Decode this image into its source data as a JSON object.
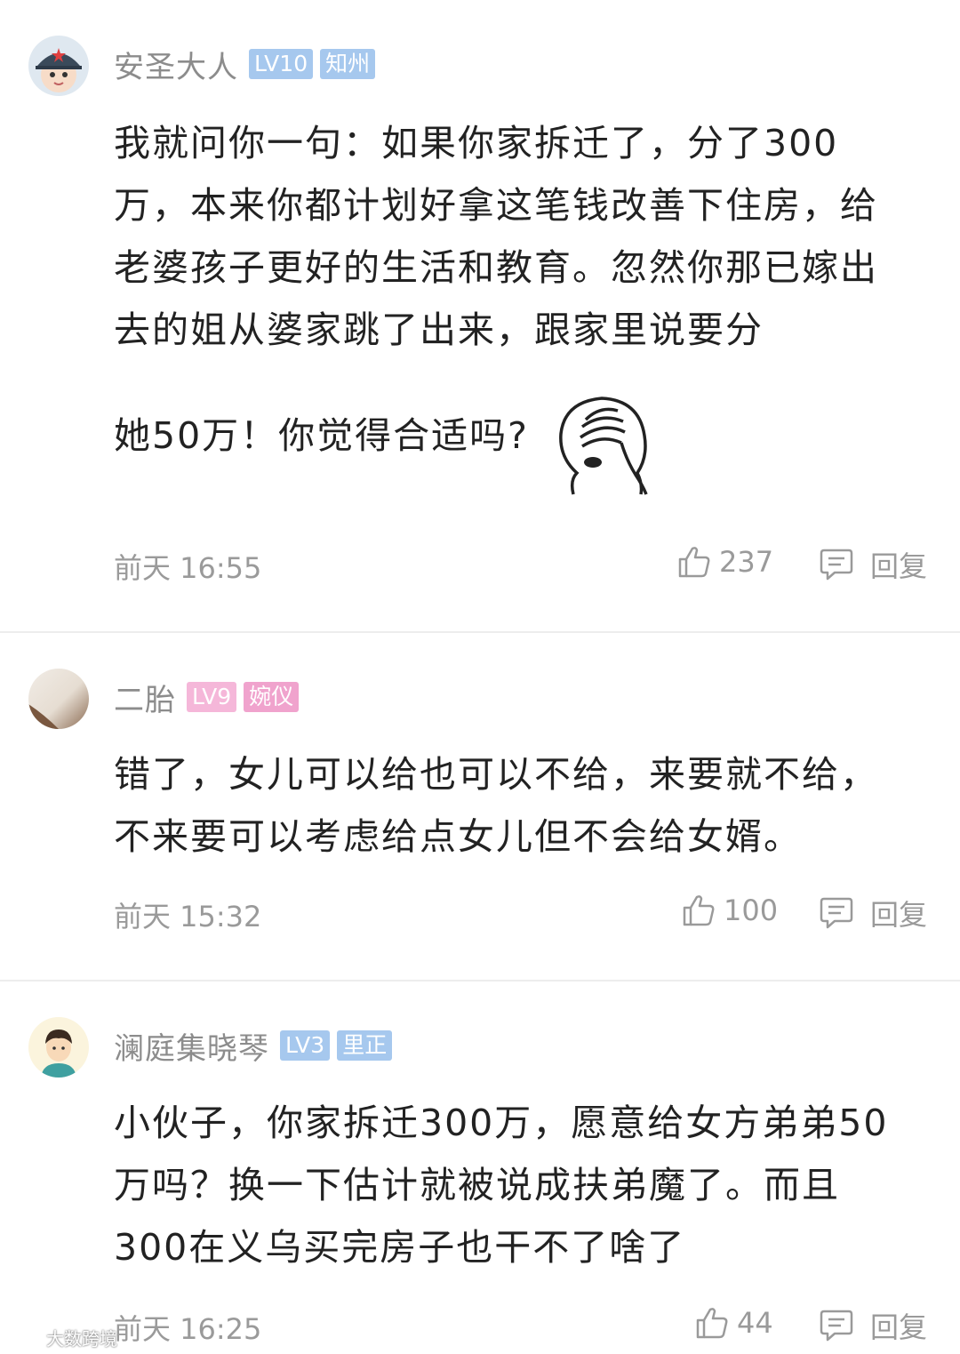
{
  "comments": [
    {
      "username": "安圣大人",
      "level": "LV10",
      "title": "知州",
      "level_color": "#a6c8ee",
      "title_color": "#a6c8ee",
      "avatar_icon": "avatar-cartoon-girl-cap-icon",
      "text": "我就问你一句：如果你家拆迁了，分了300万，本来你都计划好拿这笔钱改善下住房，给老婆孩子更好的生活和教育。忽然你那已嫁出去的姐从婆家跳了出来，跟家里说要分",
      "text_tail": "她50万！你觉得合适吗?",
      "emoji": "facepalm-emoji-icon",
      "time": "前天 16:55",
      "likes": "237",
      "reply_label": "回复"
    },
    {
      "username": "二胎",
      "level": "LV9",
      "title": "婉仪",
      "level_color": "#f5b7d9",
      "title_color": "#f0a3cd",
      "avatar_icon": "avatar-photo-icon",
      "text": "错了，女儿可以给也可以不给，来要就不给，不来要可以考虑给点女儿但不会给女婿。",
      "time": "前天 15:32",
      "likes": "100",
      "reply_label": "回复"
    },
    {
      "username": "澜庭集晓琴",
      "level": "LV3",
      "title": "里正",
      "level_color": "#a6c8ee",
      "title_color": "#a6c8ee",
      "avatar_icon": "avatar-cartoon-boy-icon",
      "text": "小伙子，你家拆迁300万，愿意给女方弟弟50万吗？换一下估计就被说成扶弟魔了。而且300在义乌买完房子也干不了啥了",
      "time": "前天 16:25",
      "likes": "44",
      "reply_label": "回复"
    }
  ],
  "watermark": "大数跨境",
  "icons": {
    "like": "thumbs-up-icon",
    "reply": "comment-bubble-icon"
  }
}
